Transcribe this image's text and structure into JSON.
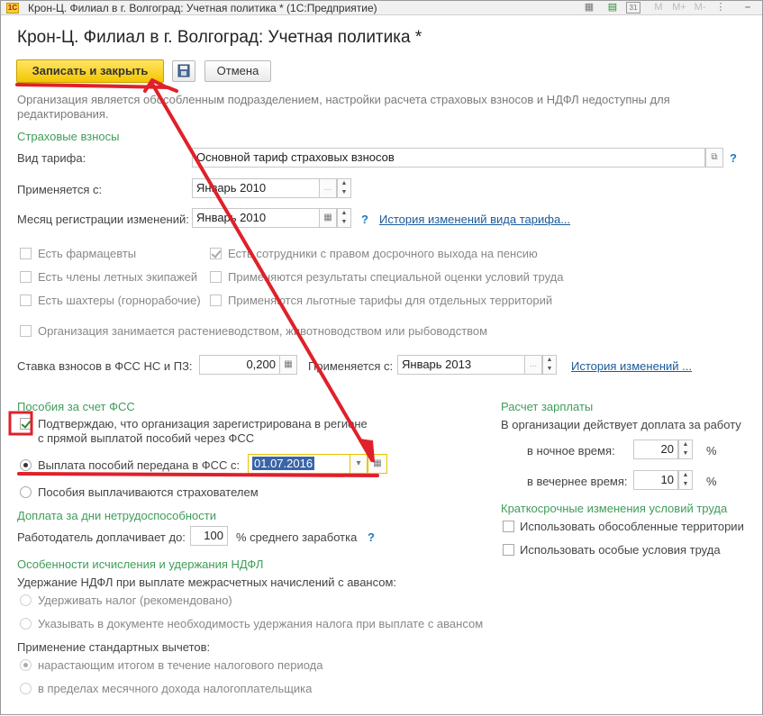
{
  "titlebar": {
    "app_title": "Крон-Ц. Филиал в г. Волгоград: Учетная политика * (1С:Предприятие)",
    "logo_text": "1C",
    "icons": [
      "calculator-icon",
      "calendar-icon",
      "memory-m-icon",
      "memory-mplus-icon",
      "memory-mminus-icon",
      "minimize-icon"
    ],
    "m_label": "M",
    "mplus_label": "M+",
    "mminus_label": "M-",
    "cal_label": "31"
  },
  "heading": "Крон-Ц. Филиал в г. Волгоград: Учетная политика *",
  "toolbar": {
    "save_close_label": "Записать и закрыть",
    "cancel_label": "Отмена"
  },
  "info_text": "Организация является обособленным подразделением, настройки расчета страховых взносов и НДФЛ недоступны для редактирования.",
  "insurance": {
    "section_title": "Страховые взносы",
    "tariff_label": "Вид тарифа:",
    "tariff_value": "Основной тариф страховых взносов",
    "applies_from_label": "Применяется с:",
    "applies_from_value": "Январь 2010",
    "reg_month_label": "Месяц регистрации изменений:",
    "reg_month_value": "Январь 2010",
    "history_link": "История изменений вида тарифа...",
    "help": "?",
    "ellipsis": "..."
  },
  "checkboxes": [
    {
      "label": "Есть фармацевты",
      "checked": false
    },
    {
      "label": "Есть члены летных экипажей",
      "checked": false
    },
    {
      "label": "Есть шахтеры (горнорабочие)",
      "checked": false
    },
    {
      "label": "Есть сотрудники с правом досрочного выхода на пенсию",
      "checked": true
    },
    {
      "label": "Применяются результаты специальной оценки условий труда",
      "checked": false
    },
    {
      "label": "Применяются льготные тарифы для отдельных территорий",
      "checked": false
    },
    {
      "label": "Организация занимается растениеводством, животноводством или рыбоводством",
      "checked": false
    }
  ],
  "fss_rate": {
    "label": "Ставка взносов в ФСС НС и ПЗ:",
    "value": "0,200",
    "applies_label": "Применяется с:",
    "applies_value": "Январь 2013",
    "history_link": "История изменений ..."
  },
  "benefits": {
    "section_title": "Пособия за счет ФСС",
    "confirm_line1": "Подтверждаю, что организация зарегистрирована в регионе",
    "confirm_line2": "с прямой выплатой пособий через ФСС",
    "confirm_checked": true,
    "radio1_label": "Выплата пособий передана в ФСС с:",
    "radio1_date": "01.07.2016",
    "radio2_label": "Пособия выплачиваются страхователем",
    "selected": "radio1"
  },
  "sick_pay": {
    "section_title": "Доплата за дни нетрудоспособности",
    "label": "Работодатель доплачивает до:",
    "value": "100",
    "suffix": "% среднего заработка",
    "help": "?"
  },
  "ndfl": {
    "section_title": "Особенности исчисления и удержания НДФЛ",
    "withholding_label": "Удержание НДФЛ при выплате межрасчетных начислений с авансом:",
    "withholding_options": [
      "Удерживать налог (рекомендовано)",
      "Указывать в документе необходимость удержания налога при выплате с авансом"
    ],
    "deductions_label": "Применение стандартных вычетов:",
    "deduction_options": [
      "нарастающим итогом в течение налогового периода",
      "в пределах месячного дохода налогоплательщика"
    ],
    "deduction_selected": 0
  },
  "payroll": {
    "section_title": "Расчет зарплаты",
    "subtitle": "В организации действует доплата за работу",
    "night_label": "в ночное время:",
    "night_value": "20",
    "evening_label": "в вечернее время:",
    "evening_value": "10",
    "percent": "%"
  },
  "short_term": {
    "section_title": "Краткосрочные изменения условий труда",
    "options": [
      "Использовать обособленные территории",
      "Использовать особые условия труда"
    ]
  },
  "colors": {
    "accent_green": "#3f9d5a",
    "save_button": "#f3c600",
    "annotation_red": "#e0202a",
    "link_blue": "#1a5a9a"
  }
}
